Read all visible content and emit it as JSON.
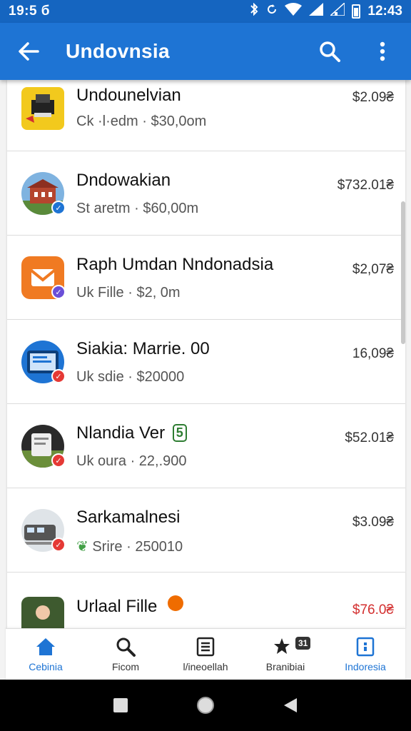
{
  "status_bar": {
    "time": "19:5 б",
    "clock": "12:43"
  },
  "app_bar": {
    "title": "Undovnsia"
  },
  "items": [
    {
      "name": "Undounelvian",
      "subtitle": "Ck ·l·edm · $30,0om",
      "price": "$2.09₴",
      "price_color": "#333333"
    },
    {
      "name": "Dndowakian",
      "subtitle": "St aretm · $60,00m",
      "price": "$732.01₴",
      "price_color": "#333333"
    },
    {
      "name": "Raph Umdan Nndonadsia",
      "subtitle": "Uk Fille · $2, 0m",
      "price": "$2,07₴",
      "price_color": "#333333"
    },
    {
      "name": "Siakia: Marrie. 00",
      "subtitle": "Uk sdie · $20000",
      "price": "16,09₴",
      "price_color": "#333333"
    },
    {
      "name": "Nlandia Ver",
      "name_badge": "5",
      "subtitle": "Uk oura · 22,.900",
      "price": "$52.01₴",
      "price_color": "#333333"
    },
    {
      "name": "Sarkamalnesi",
      "subtitle": "Srire · 250010",
      "price": "$3.09₴",
      "price_color": "#333333"
    },
    {
      "name": "Urlaal Fille",
      "subtitle": "",
      "price": "$76.0₴",
      "price_color": "#d32f2f"
    }
  ],
  "bottom_nav": [
    {
      "label": "Cebinia",
      "icon": "home-icon",
      "active": true
    },
    {
      "label": "Ficom",
      "icon": "search-icon",
      "active": false
    },
    {
      "label": "l/ineoellah",
      "icon": "list-icon",
      "active": false
    },
    {
      "label": "Branibiai",
      "icon": "star-icon",
      "badge": "31",
      "active": false
    },
    {
      "label": "Indoresia",
      "icon": "info-icon",
      "active": true
    }
  ],
  "colors": {
    "primary": "#1e74d4",
    "status_bar": "#1565c0",
    "accent_red": "#d32f2f",
    "badge_blue": "#1e74d4",
    "badge_purple": "#6a4fd8",
    "badge_red": "#e53935",
    "badge_orange": "#ef6c00",
    "badge_green": "#2e7d32"
  }
}
